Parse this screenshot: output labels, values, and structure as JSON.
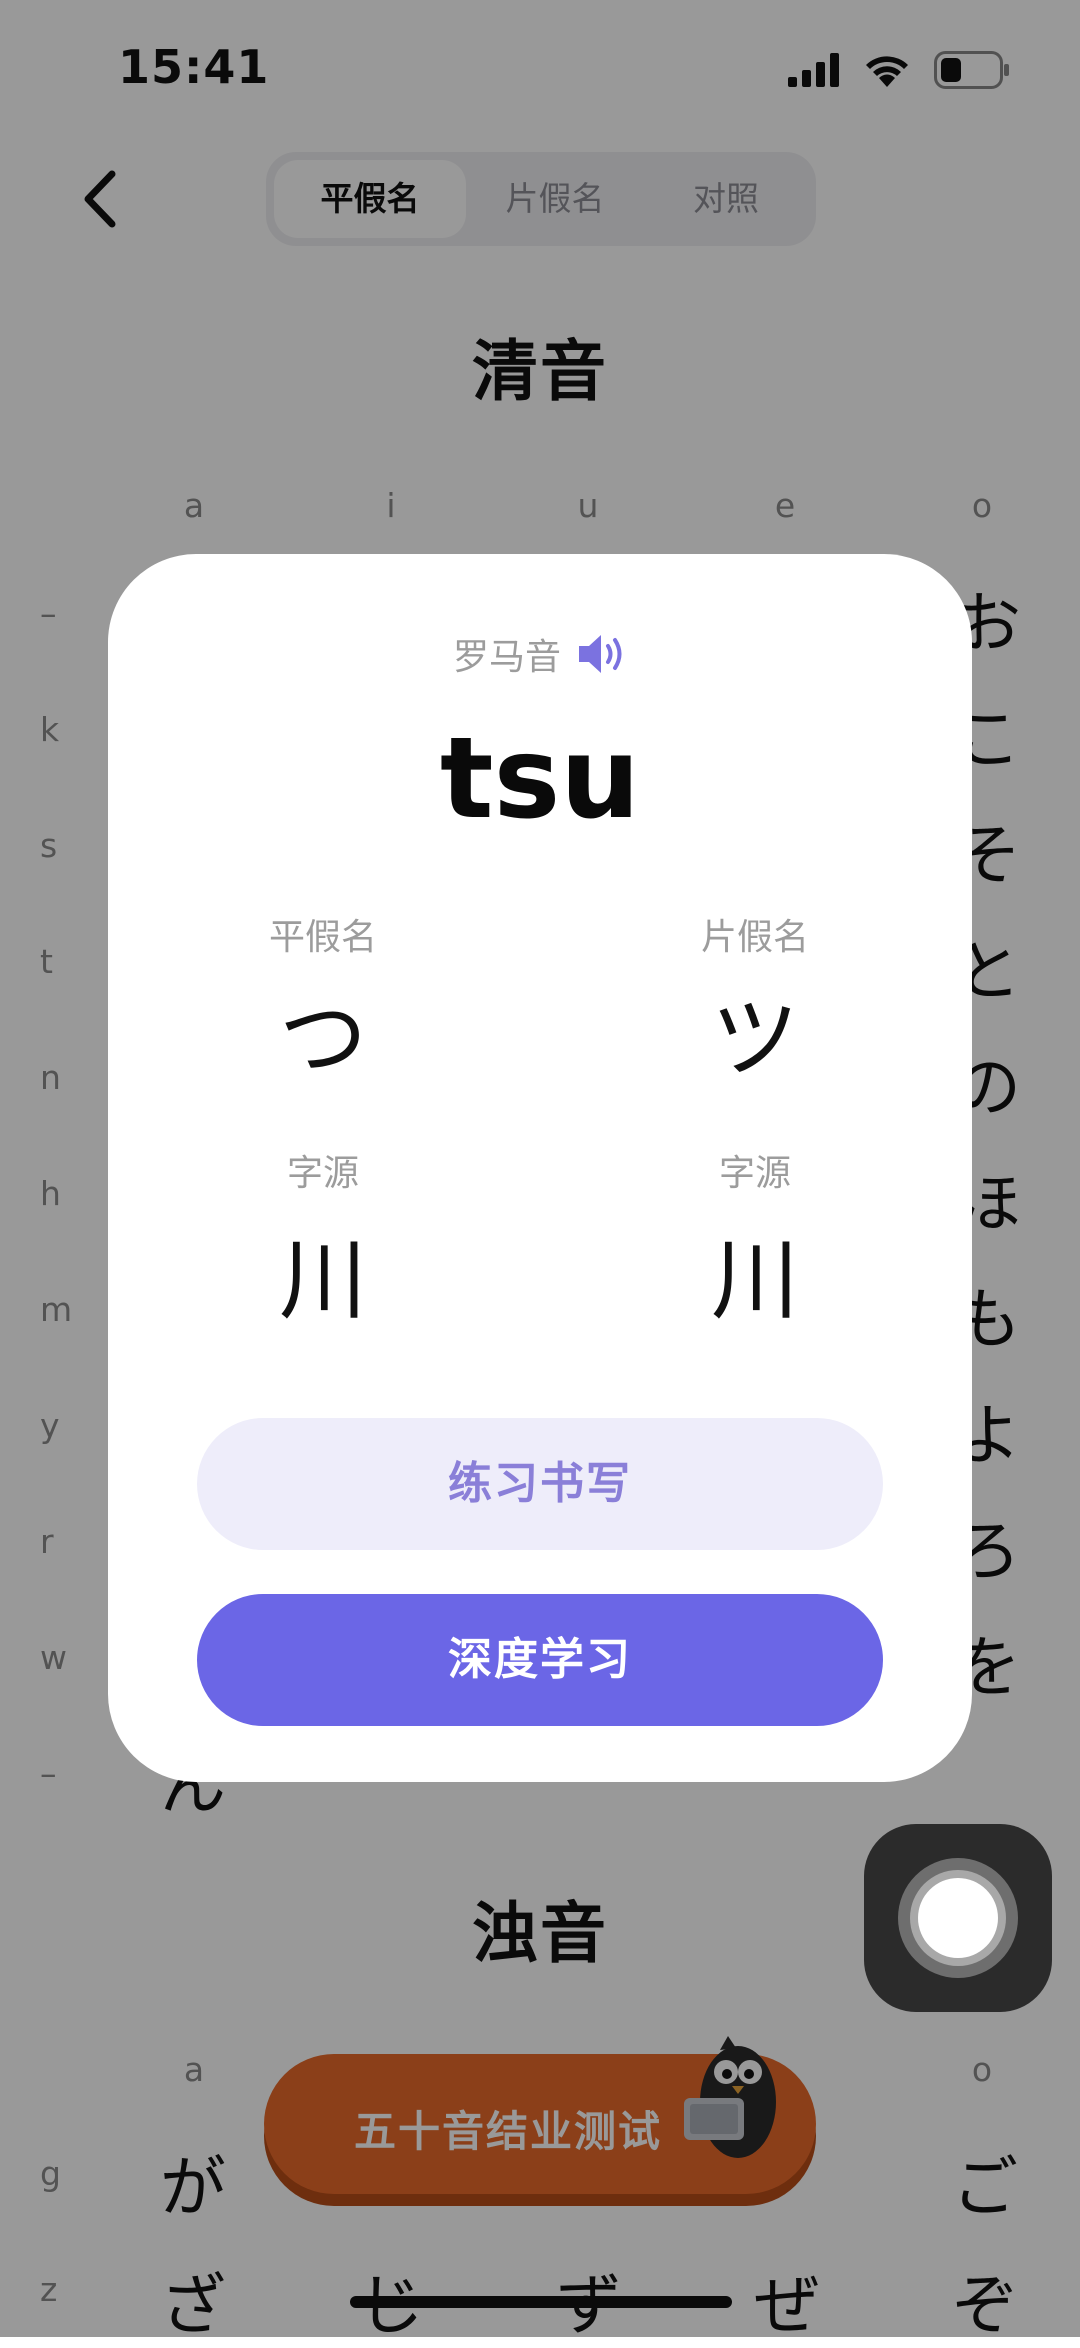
{
  "status": {
    "time": "15:41"
  },
  "tabs": [
    {
      "label": "平假名",
      "active": true
    },
    {
      "label": "片假名",
      "active": false
    },
    {
      "label": "对照",
      "active": false
    }
  ],
  "sections": {
    "seion": "清音",
    "dakuon": "浊音"
  },
  "grid": {
    "columns": [
      "a",
      "i",
      "u",
      "e",
      "o"
    ],
    "seion_rows": [
      "–",
      "k",
      "s",
      "t",
      "n",
      "h",
      "m",
      "y",
      "r",
      "w",
      "–"
    ],
    "seion_o_column": [
      "お",
      "こ",
      "そ",
      "と",
      "の",
      "ほ",
      "も",
      "よ",
      "ろ",
      "を"
    ],
    "seion_last_row_a": "ん",
    "dakuon_rows": [
      "g",
      "z"
    ],
    "dakuon_row_g": [
      "が",
      "",
      "",
      "",
      "ご"
    ],
    "dakuon_row_z": [
      "ざ",
      "じ",
      "ず",
      "ぜ",
      "ぞ"
    ]
  },
  "final_test_button": "五十音结业测试",
  "modal": {
    "romaji_label": "罗马音",
    "romaji": "tsu",
    "hiragana_label": "平假名",
    "hiragana": "つ",
    "katakana_label": "片假名",
    "katakana": "ツ",
    "origin_label_left": "字源",
    "origin_left": "川",
    "origin_label_right": "字源",
    "origin_right": "川",
    "practice_button": "练习书写",
    "deep_button": "深度学习"
  },
  "colors": {
    "accent": "#6b66e6",
    "accent_light": "#eeedfa",
    "test_button": "#e86a2a"
  },
  "icons": [
    "back-icon",
    "signal-icon",
    "wifi-icon",
    "battery-icon",
    "speaker-icon",
    "assistive-touch-icon",
    "mascot-icon"
  ]
}
